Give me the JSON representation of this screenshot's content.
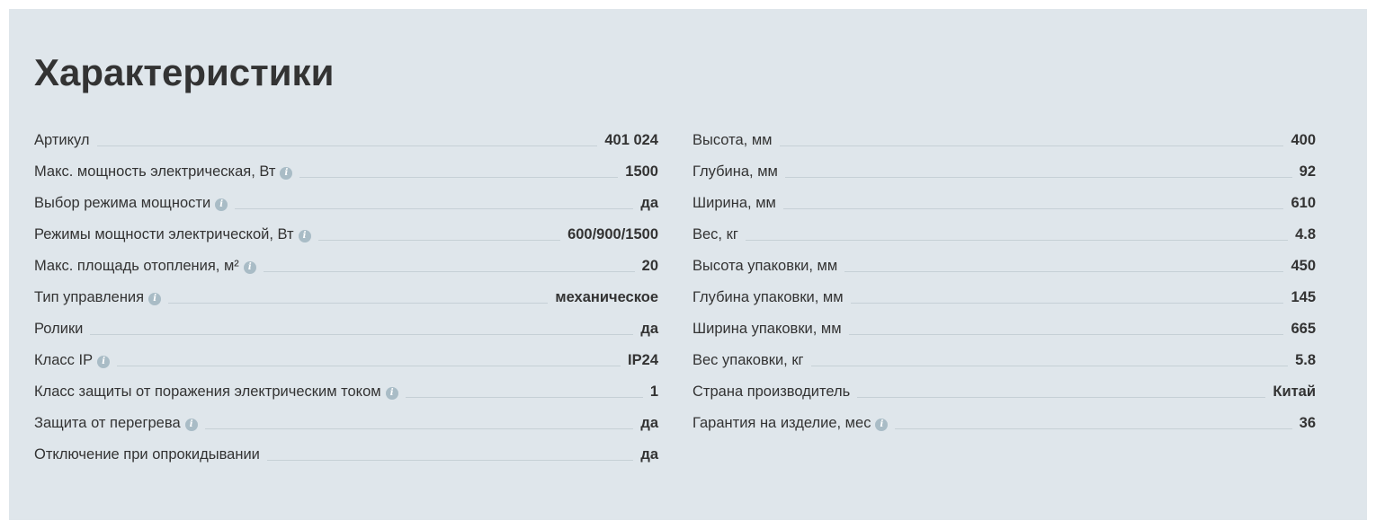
{
  "title": "Характеристики",
  "left": [
    {
      "label": "Артикул",
      "info": false,
      "value": "401 024"
    },
    {
      "label": "Макс. мощность электрическая, Вт",
      "info": true,
      "value": "1500"
    },
    {
      "label": "Выбор режима мощности",
      "info": true,
      "value": "да"
    },
    {
      "label": "Режимы мощности электрической, Вт",
      "info": true,
      "value": "600/900/1500"
    },
    {
      "label": "Макс. площадь отопления, м²",
      "info": true,
      "value": "20"
    },
    {
      "label": "Тип управления",
      "info": true,
      "value": "механическое"
    },
    {
      "label": "Ролики",
      "info": false,
      "value": "да"
    },
    {
      "label": "Класс IP",
      "info": true,
      "value": "IP24"
    },
    {
      "label": "Класс защиты от поражения электрическим током",
      "info": true,
      "value": "1"
    },
    {
      "label": "Защита от перегрева",
      "info": true,
      "value": "да"
    },
    {
      "label": "Отключение при опрокидывании",
      "info": false,
      "value": "да"
    }
  ],
  "right": [
    {
      "label": "Высота, мм",
      "info": false,
      "value": "400"
    },
    {
      "label": "Глубина, мм",
      "info": false,
      "value": "92"
    },
    {
      "label": "Ширина, мм",
      "info": false,
      "value": "610"
    },
    {
      "label": "Вес, кг",
      "info": false,
      "value": "4.8"
    },
    {
      "label": "Высота упаковки, мм",
      "info": false,
      "value": "450"
    },
    {
      "label": "Глубина упаковки, мм",
      "info": false,
      "value": "145"
    },
    {
      "label": "Ширина упаковки, мм",
      "info": false,
      "value": "665"
    },
    {
      "label": "Вес упаковки, кг",
      "info": false,
      "value": "5.8"
    },
    {
      "label": "Страна производитель",
      "info": false,
      "value": "Китай"
    },
    {
      "label": "Гарантия на изделие, мес",
      "info": true,
      "value": "36"
    }
  ],
  "info_glyph": "i",
  "info_icon": "info-circle-icon",
  "colors": {
    "background": "#dfe6eb",
    "text": "#333333",
    "info_icon": "#a9bcc6",
    "leader": "#c6d0d6"
  }
}
